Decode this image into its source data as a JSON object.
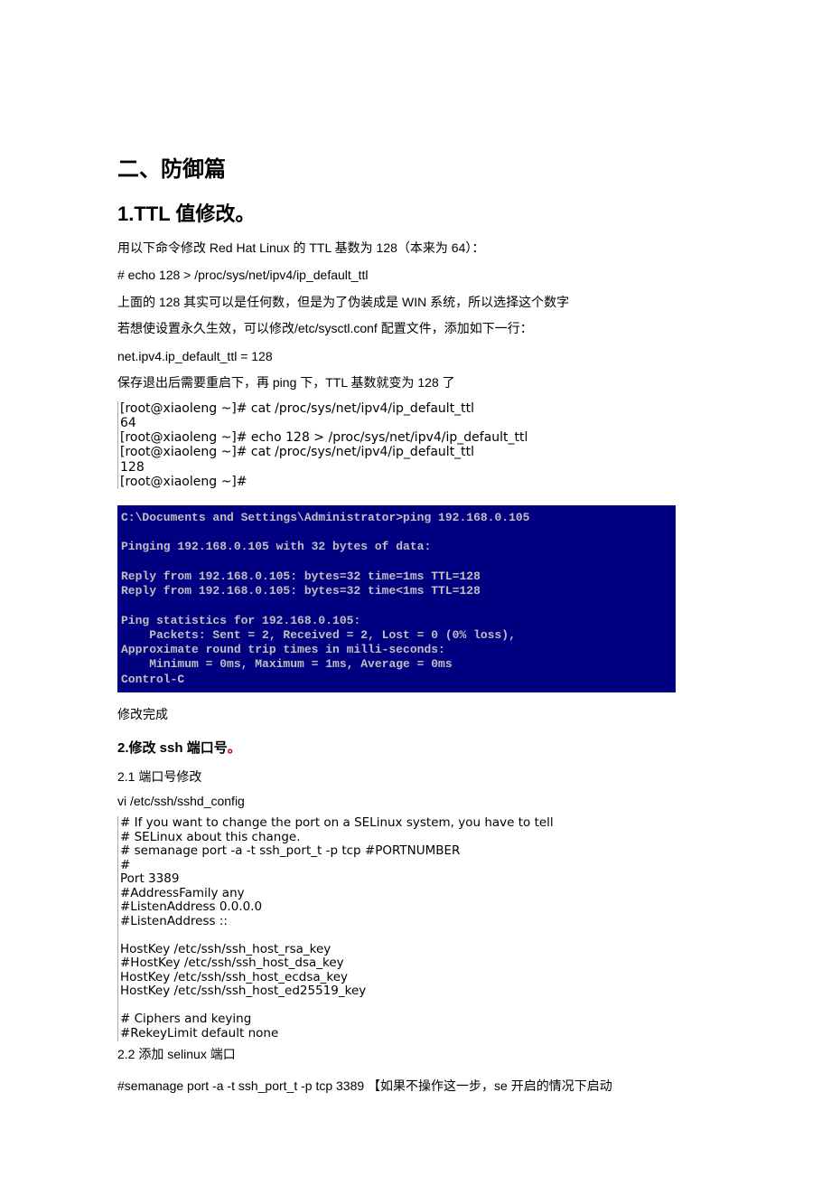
{
  "heading1": "二、防御篇",
  "heading2": "1.TTL 值修改。",
  "p1": "用以下命令修改 Red Hat Linux 的 TTL 基数为 128（本来为 64）：",
  "cmd1": "# echo 128 > /proc/sys/net/ipv4/ip_default_ttl",
  "p2": "上面的 128 其实可以是任何数，但是为了伪装成是 WIN 系统，所以选择这个数字",
  "p3": "若想使设置永久生效，可以修改/etc/sysctl.conf 配置文件，添加如下一行：",
  "cfg1": "net.ipv4.ip_default_ttl = 128",
  "p4": "保存退出后需要重启下，再 ping  下，TTL 基数就变为 128 了",
  "term1": "[root@xiaoleng ~]# cat /proc/sys/net/ipv4/ip_default_ttl\n64\n[root@xiaoleng ~]# echo 128 > /proc/sys/net/ipv4/ip_default_ttl\n[root@xiaoleng ~]# cat /proc/sys/net/ipv4/ip_default_ttl\n128\n[root@xiaoleng ~]#",
  "term2": "C:\\Documents and Settings\\Administrator>ping 192.168.0.105\n\nPinging 192.168.0.105 with 32 bytes of data:\n\nReply from 192.168.0.105: bytes=32 time=1ms TTL=128\nReply from 192.168.0.105: bytes=32 time<1ms TTL=128\n\nPing statistics for 192.168.0.105:\n    Packets: Sent = 2, Received = 2, Lost = 0 (0% loss),\nApproximate round trip times in milli-seconds:\n    Minimum = 0ms, Maximum = 1ms, Average = 0ms\nControl-C",
  "done": "修改完成",
  "heading3_main": "2.修改 ssh 端口号",
  "heading3_dot": "。",
  "sub1": "2.1 端口号修改",
  "cmd2": "vi /etc/ssh/sshd_config",
  "term3": "# If you want to change the port on a SELinux system, you have to tell\n# SELinux about this change.\n# semanage port -a -t ssh_port_t -p tcp #PORTNUMBER\n#\nPort 3389\n#AddressFamily any\n#ListenAddress 0.0.0.0\n#ListenAddress ::\n\nHostKey /etc/ssh/ssh_host_rsa_key\n#HostKey /etc/ssh/ssh_host_dsa_key\nHostKey /etc/ssh/ssh_host_ecdsa_key\nHostKey /etc/ssh/ssh_host_ed25519_key\n\n# Ciphers and keying\n#RekeyLimit default none",
  "sub2": "2.2  添加 selinux 端口",
  "final": "#semanage port -a -t ssh_port_t -p tcp 3389 【如果不操作这一步，se 开启的情况下启动"
}
